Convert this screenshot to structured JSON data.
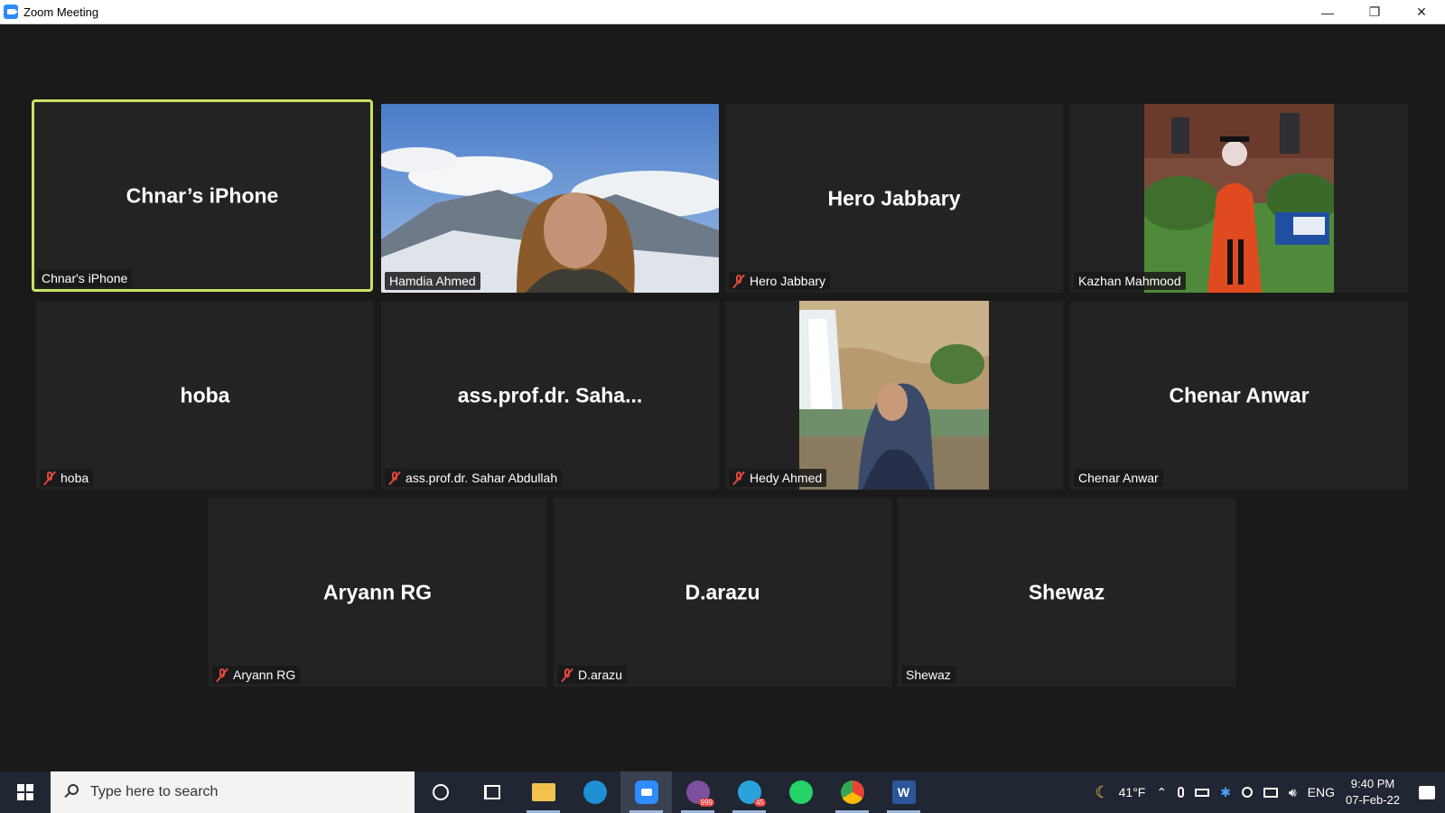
{
  "window": {
    "title": "Zoom Meeting"
  },
  "participants": [
    {
      "center_name": "Chnar’s iPhone",
      "label": "Chnar's iPhone",
      "muted": false
    },
    {
      "center_name": "",
      "label": "Hamdia Ahmed",
      "muted": false
    },
    {
      "center_name": "Hero Jabbary",
      "label": "Hero Jabbary",
      "muted": true
    },
    {
      "center_name": "",
      "label": "Kazhan Mahmood",
      "muted": false
    },
    {
      "center_name": "hoba",
      "label": "hoba",
      "muted": true
    },
    {
      "center_name": "ass.prof.dr.  Saha...",
      "label": "ass.prof.dr. Sahar Abdullah",
      "muted": true
    },
    {
      "center_name": "",
      "label": "Hedy Ahmed",
      "muted": true
    },
    {
      "center_name": "Chenar Anwar",
      "label": "Chenar Anwar",
      "muted": false
    },
    {
      "center_name": "Aryann RG",
      "label": "Aryann RG",
      "muted": true
    },
    {
      "center_name": "D.arazu",
      "label": "D.arazu",
      "muted": true
    },
    {
      "center_name": "Shewaz",
      "label": "Shewaz",
      "muted": false
    }
  ],
  "taskbar": {
    "search_placeholder": "Type here to search",
    "weather": "41°F",
    "language": "ENG",
    "time": "9:40 PM",
    "date": "07-Feb-22",
    "viber_badge": "999",
    "telegram_badge": "45"
  }
}
